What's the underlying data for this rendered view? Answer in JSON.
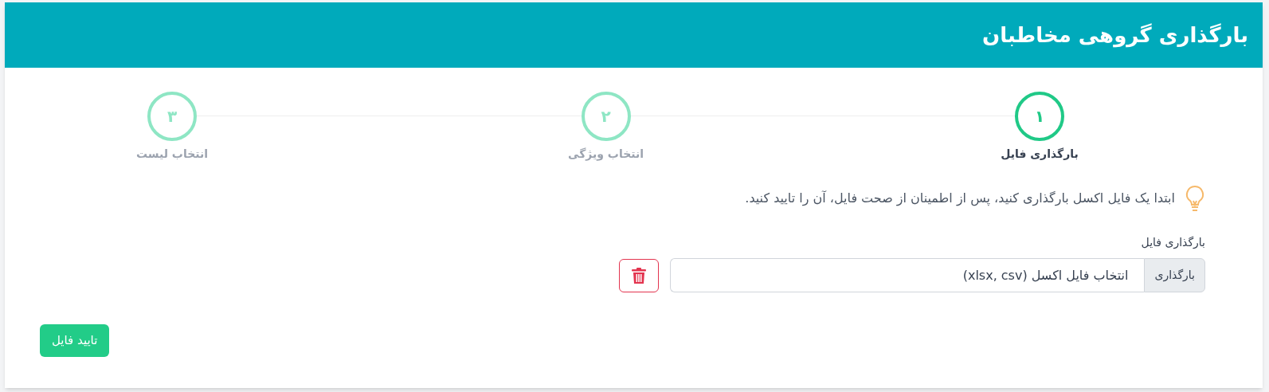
{
  "header": {
    "title": "بارگذاری گروهی مخاطبان"
  },
  "steps": [
    {
      "number": "۱",
      "label": "بارگذاری فایل",
      "selected": true
    },
    {
      "number": "۲",
      "label": "انتخاب ویژگی",
      "selected": false
    },
    {
      "number": "۳",
      "label": "انتخاب لیست",
      "selected": false
    }
  ],
  "hint": "ابتدا یک فایل اکسل بارگذاری کنید، پس از اطمینان از صحت فایل، آن را تایید کنید.",
  "file_field": {
    "label": "بارگذاری فایل",
    "button": "بارگذاری",
    "placeholder": "انتخاب فایل اکسل (xlsx, csv)"
  },
  "confirm_button": "تایید فایل"
}
